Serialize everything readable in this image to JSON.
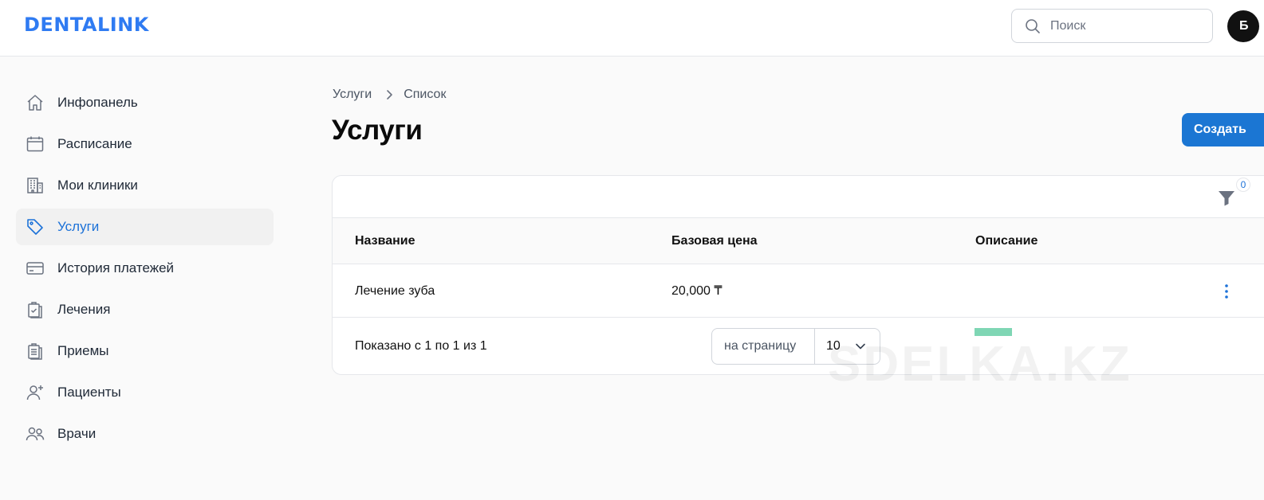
{
  "header": {
    "logo": "DENTALINK",
    "search_placeholder": "Поиск",
    "avatar_initial": "Б"
  },
  "sidebar": {
    "items": [
      {
        "label": "Инфопанель",
        "icon": "home-icon"
      },
      {
        "label": "Расписание",
        "icon": "calendar-icon"
      },
      {
        "label": "Мои клиники",
        "icon": "building-icon"
      },
      {
        "label": "Услуги",
        "icon": "tag-icon",
        "active": true
      },
      {
        "label": "История платежей",
        "icon": "credit-card-icon"
      },
      {
        "label": "Лечения",
        "icon": "clipboard-check-icon"
      },
      {
        "label": "Приемы",
        "icon": "clipboard-list-icon"
      },
      {
        "label": "Пациенты",
        "icon": "user-plus-icon"
      },
      {
        "label": "Врачи",
        "icon": "users-icon"
      }
    ]
  },
  "breadcrumb": {
    "root": "Услуги",
    "current": "Список"
  },
  "page": {
    "title": "Услуги",
    "create_label": "Создать"
  },
  "table": {
    "filter_count": "0",
    "columns": [
      "Название",
      "Базовая цена",
      "Описание"
    ],
    "rows": [
      {
        "name": "Лечение зуба",
        "price": "20,000 ₸",
        "description": ""
      }
    ],
    "summary": "Показано с 1 по 1 из 1",
    "per_page_label": "на страницу",
    "per_page_value": "10"
  },
  "watermark": "SDELKA.KZ",
  "colors": {
    "brand": "#2f7bf2",
    "primary": "#1b76d3",
    "active_text": "#1d72d8"
  }
}
